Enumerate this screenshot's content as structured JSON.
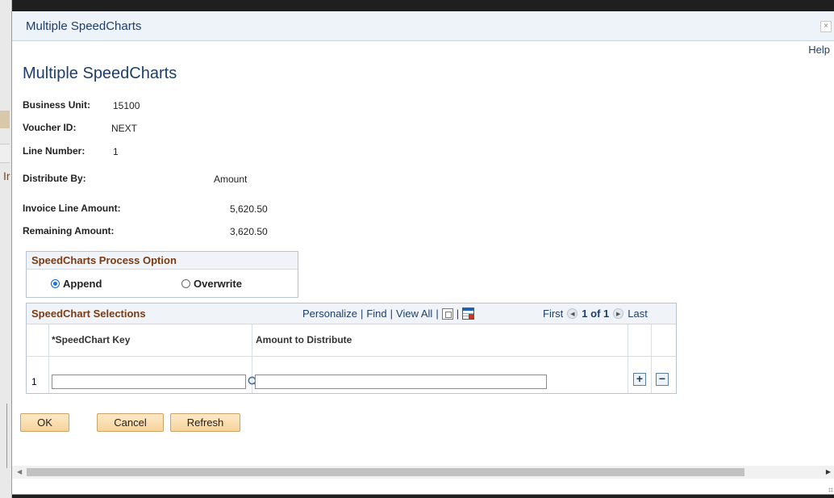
{
  "modal": {
    "title": "Multiple SpeedCharts",
    "close_glyph": "×",
    "help_label": "Help",
    "page_title": "Multiple SpeedCharts"
  },
  "fields": {
    "business_unit_label": "Business Unit:",
    "business_unit_value": "15100",
    "voucher_id_label": "Voucher ID:",
    "voucher_id_value": "NEXT",
    "line_number_label": "Line Number:",
    "line_number_value": "1",
    "distribute_by_label": "Distribute By:",
    "distribute_by_value": "Amount",
    "invoice_line_amount_label": "Invoice Line Amount:",
    "invoice_line_amount_value": "5,620.50",
    "remaining_amount_label": "Remaining Amount:",
    "remaining_amount_value": "3,620.50"
  },
  "process_option": {
    "title": "SpeedCharts Process Option",
    "options": [
      {
        "label": "Append",
        "selected": true
      },
      {
        "label": "Overwrite",
        "selected": false
      }
    ]
  },
  "grid": {
    "title": "SpeedChart Selections",
    "personalize": "Personalize",
    "find": "Find",
    "view_all": "View All",
    "first": "First",
    "count": "1 of 1",
    "last": "Last",
    "columns": [
      "*SpeedChart Key",
      "Amount to Distribute"
    ],
    "rows": [
      {
        "num": "1",
        "speedchart_key": "",
        "amount": ""
      }
    ]
  },
  "buttons": {
    "ok": "OK",
    "cancel": "Cancel",
    "refresh": "Refresh"
  },
  "colors": {
    "title_blue": "#1d3e6a",
    "section_brown": "#7a3b12",
    "button_fill": "#f6d49a"
  }
}
